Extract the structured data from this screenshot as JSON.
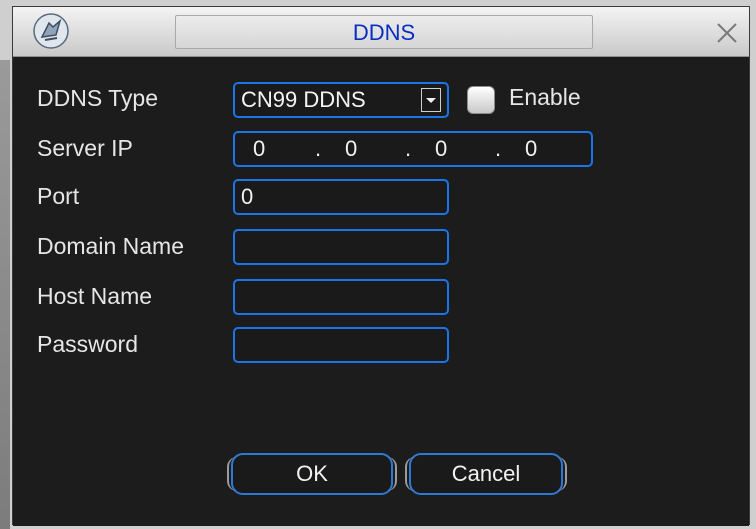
{
  "window": {
    "title": "DDNS",
    "title_color": "#0a2ec2",
    "close_icon": "close-icon",
    "app_icon": "device-icon"
  },
  "form": {
    "ddns_type": {
      "label": "DDNS Type",
      "selected": "CN99 DDNS",
      "enable_label": "Enable",
      "enable_checked": false
    },
    "server_ip": {
      "label": "Server IP",
      "octets": [
        "0",
        "0",
        "0",
        "0"
      ],
      "separator": "."
    },
    "port": {
      "label": "Port",
      "value": "0"
    },
    "domain_name": {
      "label": "Domain Name",
      "value": ""
    },
    "host_name": {
      "label": "Host Name",
      "value": ""
    },
    "password": {
      "label": "Password",
      "value": ""
    }
  },
  "buttons": {
    "ok": "OK",
    "cancel": "Cancel"
  },
  "colors": {
    "field_border": "#1b74e8",
    "background": "#1c1c1c",
    "text": "#e6e6e6"
  }
}
